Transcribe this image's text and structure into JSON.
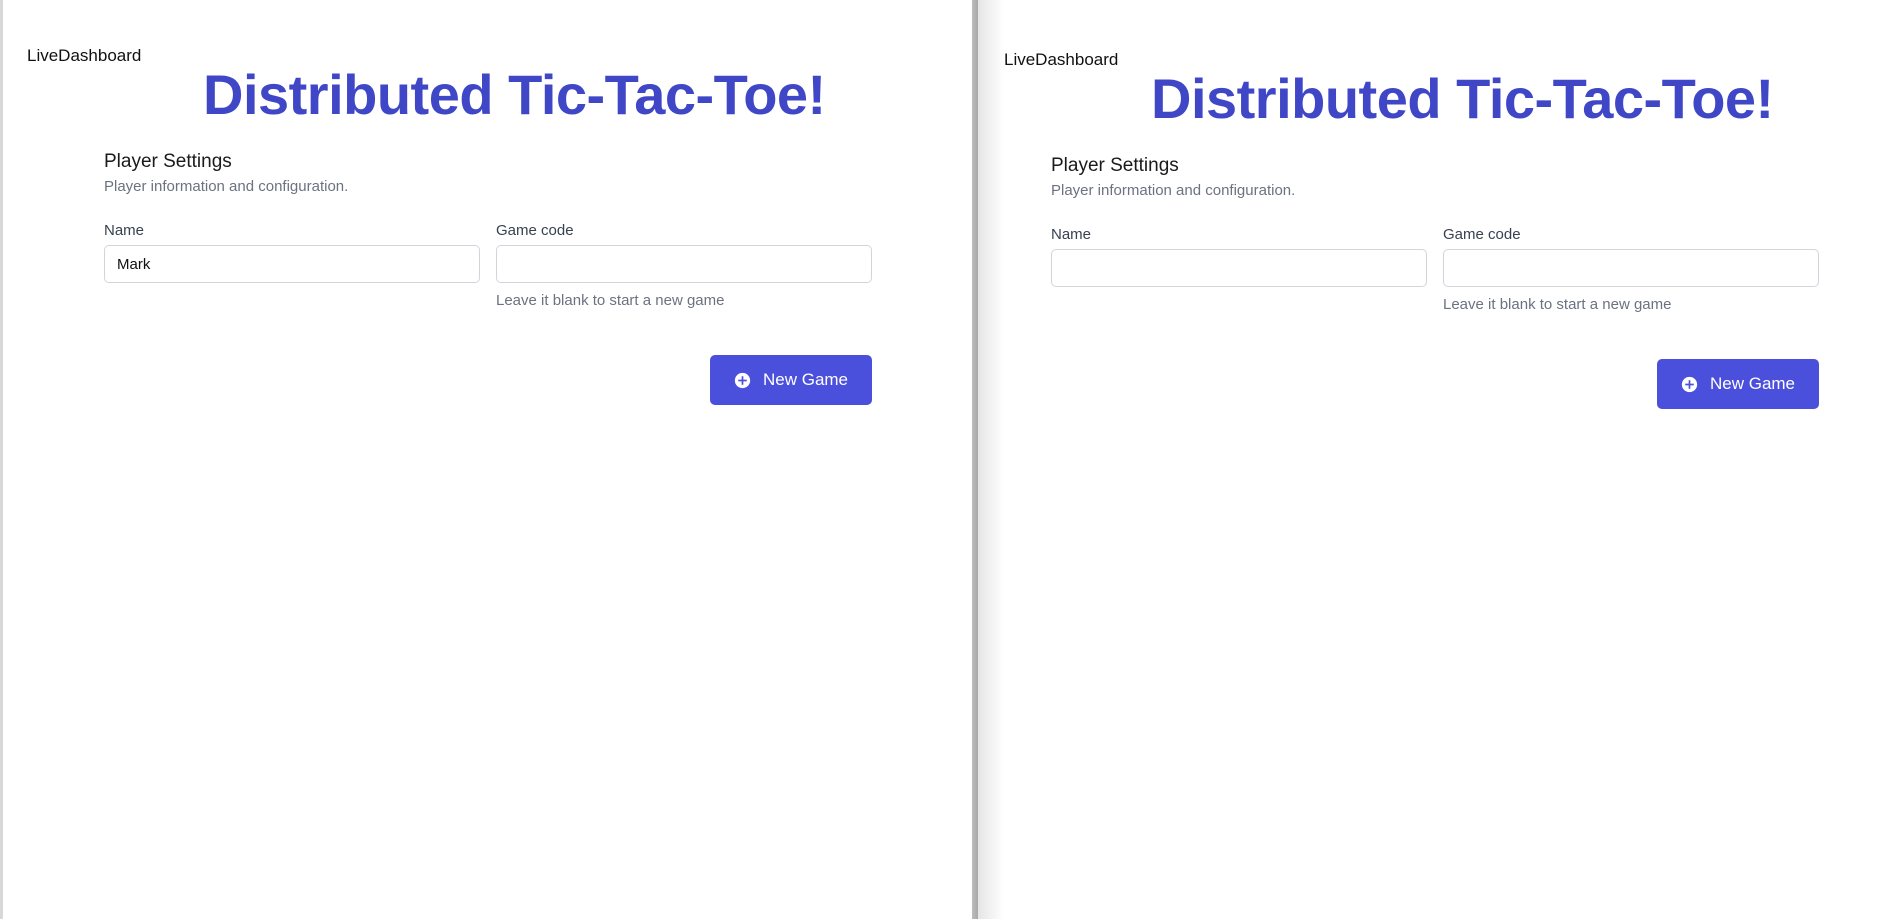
{
  "windows": [
    {
      "brand_link": "LiveDashboard",
      "title": "Distributed Tic-Tac-Toe!",
      "section_title": "Player Settings",
      "section_desc": "Player information and configuration.",
      "name_label": "Name",
      "name_value": "Mark",
      "game_code_label": "Game code",
      "game_code_value": "",
      "game_code_hint": "Leave it blank to start a new game",
      "new_game_label": "New Game",
      "new_game_icon": "plus-circle-icon"
    },
    {
      "brand_link": "LiveDashboard",
      "title": "Distributed Tic-Tac-Toe!",
      "section_title": "Player Settings",
      "section_desc": "Player information and configuration.",
      "name_label": "Name",
      "name_value": "",
      "game_code_label": "Game code",
      "game_code_value": "",
      "game_code_hint": "Leave it blank to start a new game",
      "new_game_label": "New Game",
      "new_game_icon": "plus-circle-icon"
    }
  ],
  "colors": {
    "title": "#4047c7",
    "button": "#4a4fdc",
    "muted_text": "#6b7280"
  }
}
